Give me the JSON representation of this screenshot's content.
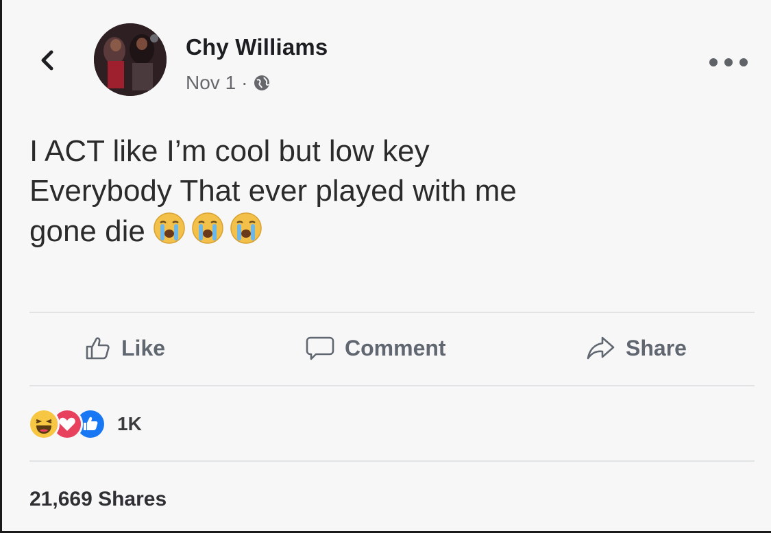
{
  "post": {
    "author_name": "Chy Williams",
    "date": "Nov 1",
    "separator": "·",
    "audience_icon": "globe-icon",
    "text_lines": [
      "I ACT like I’m cool but low key",
      "Everybody That ever played with me",
      "gone die"
    ],
    "emojis": [
      "loudly-crying-face",
      "loudly-crying-face",
      "loudly-crying-face"
    ]
  },
  "actions": {
    "like_label": "Like",
    "comment_label": "Comment",
    "share_label": "Share"
  },
  "reactions": {
    "icons": [
      "haha-reaction-icon",
      "love-reaction-icon",
      "like-reaction-icon"
    ],
    "count": "1K"
  },
  "shares": {
    "label": "21,669 Shares"
  },
  "colors": {
    "text": "#2b2b2b",
    "muted": "#65676b",
    "like_blue": "#1877f2",
    "love_red": "#e8415e",
    "haha_yellow": "#f7c744"
  }
}
